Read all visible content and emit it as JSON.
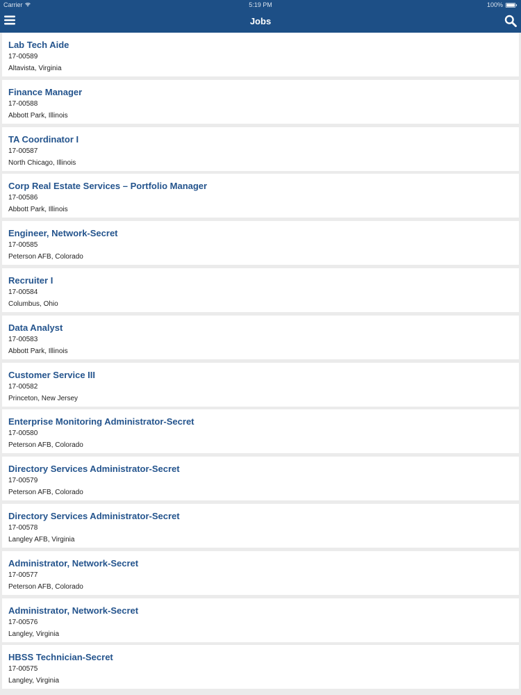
{
  "status_bar": {
    "carrier": "Carrier",
    "time": "5:19 PM",
    "battery": "100%"
  },
  "nav": {
    "title": "Jobs",
    "menu_icon": "hamburger-menu-icon",
    "search_icon": "search-icon"
  },
  "colors": {
    "nav_background": "#1d4f86",
    "job_title": "#24548d",
    "list_background": "#ebebeb"
  },
  "jobs": [
    {
      "title": "Lab Tech Aide",
      "id": "17-00589",
      "location": "Altavista, Virginia"
    },
    {
      "title": "Finance Manager",
      "id": "17-00588",
      "location": "Abbott Park, Illinois"
    },
    {
      "title": "TA Coordinator I",
      "id": "17-00587",
      "location": "North Chicago, Illinois"
    },
    {
      "title": "Corp Real Estate Services – Portfolio Manager",
      "id": "17-00586",
      "location": "Abbott Park, Illinois"
    },
    {
      "title": "Engineer, Network-Secret",
      "id": "17-00585",
      "location": "Peterson AFB, Colorado"
    },
    {
      "title": "Recruiter I",
      "id": "17-00584",
      "location": "Columbus, Ohio"
    },
    {
      "title": "Data Analyst",
      "id": "17-00583",
      "location": "Abbott Park, Illinois"
    },
    {
      "title": "Customer Service III",
      "id": "17-00582",
      "location": "Princeton, New Jersey"
    },
    {
      "title": "Enterprise Monitoring Administrator-Secret",
      "id": "17-00580",
      "location": "Peterson AFB, Colorado"
    },
    {
      "title": "Directory Services Administrator-Secret",
      "id": "17-00579",
      "location": "Peterson AFB, Colorado"
    },
    {
      "title": "Directory Services Administrator-Secret",
      "id": "17-00578",
      "location": "Langley AFB, Virginia"
    },
    {
      "title": "Administrator, Network-Secret",
      "id": "17-00577",
      "location": "Peterson AFB, Colorado"
    },
    {
      "title": "Administrator, Network-Secret",
      "id": "17-00576",
      "location": "Langley, Virginia"
    },
    {
      "title": "HBSS Technician-Secret",
      "id": "17-00575",
      "location": "Langley, Virginia"
    }
  ]
}
